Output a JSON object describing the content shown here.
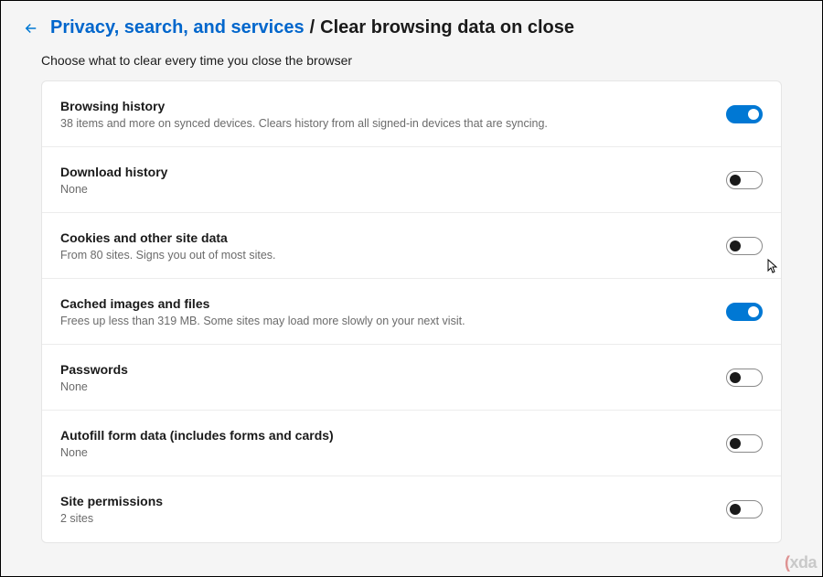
{
  "header": {
    "breadcrumb_link": "Privacy, search, and services",
    "breadcrumb_sep": "/",
    "breadcrumb_current": "Clear browsing data on close"
  },
  "subheader": "Choose what to clear every time you close the browser",
  "rows": [
    {
      "title": "Browsing history",
      "desc": "38 items and more on synced devices. Clears history from all signed-in devices that are syncing.",
      "on": true
    },
    {
      "title": "Download history",
      "desc": "None",
      "on": false
    },
    {
      "title": "Cookies and other site data",
      "desc": "From 80 sites. Signs you out of most sites.",
      "on": false
    },
    {
      "title": "Cached images and files",
      "desc": "Frees up less than 319 MB. Some sites may load more slowly on your next visit.",
      "on": true
    },
    {
      "title": "Passwords",
      "desc": "None",
      "on": false
    },
    {
      "title": "Autofill form data (includes forms and cards)",
      "desc": "None",
      "on": false
    },
    {
      "title": "Site permissions",
      "desc": "2 sites",
      "on": false
    }
  ],
  "watermark": {
    "prefix": "(",
    "brand": "xda"
  }
}
